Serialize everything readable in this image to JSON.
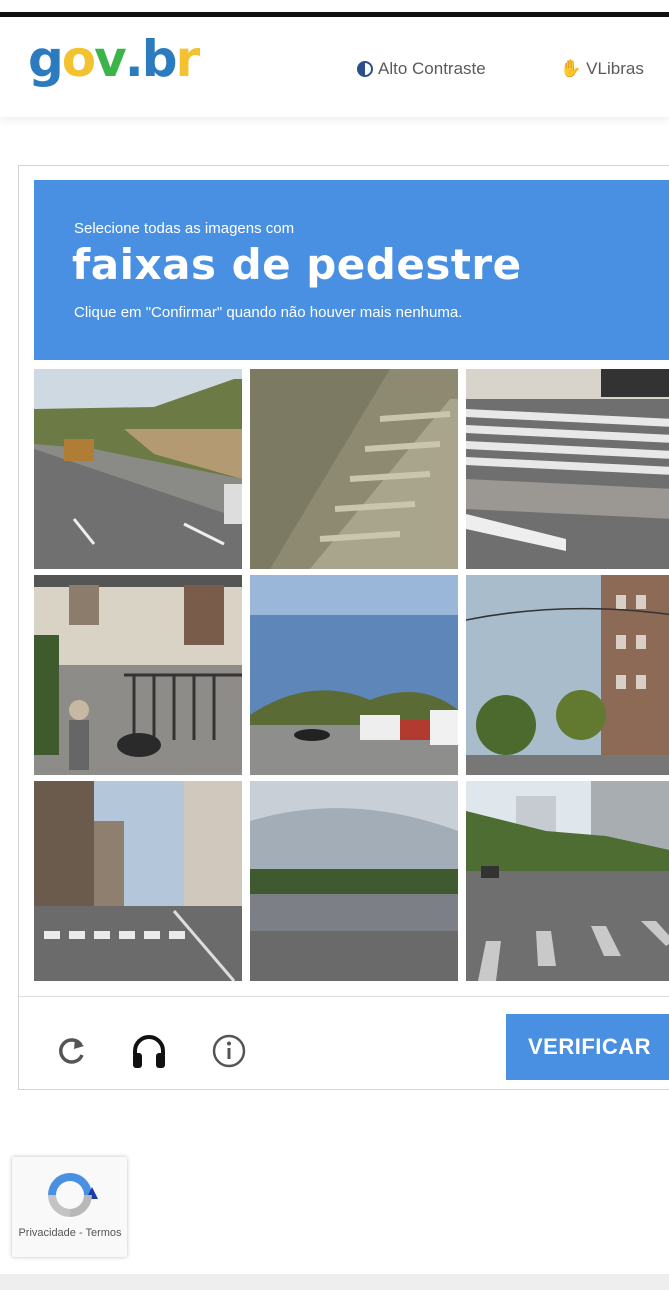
{
  "header": {
    "logo_letters": [
      {
        "char": "g",
        "color": "#2d7bbf"
      },
      {
        "char": "o",
        "color": "#f2c230"
      },
      {
        "char": "v",
        "color": "#3bb44a"
      },
      {
        "char": ".",
        "color": "#2d7bbf"
      },
      {
        "char": "b",
        "color": "#2d7bbf"
      },
      {
        "char": "r",
        "color": "#f2c230"
      }
    ],
    "contrast_label": "Alto Contraste",
    "vlibras_label": "VLibras"
  },
  "challenge": {
    "instruction_line1": "Selecione todas as imagens com",
    "instruction_keyword": "faixas de pedestre",
    "instruction_line3": "Clique em \"Confirmar\" quando não houver mais nenhuma.",
    "banner_color": "#4a90e2",
    "tiles": [
      {
        "scene": "highway-hillside"
      },
      {
        "scene": "stone-stairs"
      },
      {
        "scene": "crosswalk-corner"
      },
      {
        "scene": "building-motorcycle"
      },
      {
        "scene": "bridge-trucks"
      },
      {
        "scene": "street-buildings"
      },
      {
        "scene": "city-crosswalk"
      },
      {
        "scene": "river-embankment"
      },
      {
        "scene": "wide-road-crosswalk"
      }
    ],
    "reload_icon": "reload-icon",
    "audio_icon": "headphones-icon",
    "info_icon": "info-icon",
    "verify_label": "VERIFICAR",
    "accent_color": "#4a90e2"
  },
  "recaptcha_badge": {
    "privacy_label": "Privacidade - Termos"
  }
}
